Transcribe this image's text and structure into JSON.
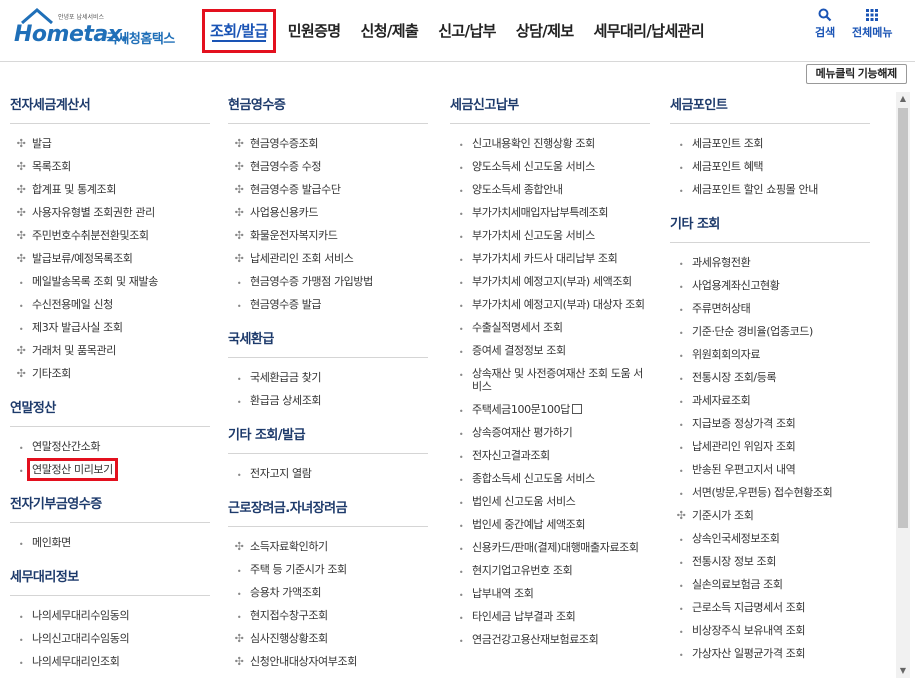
{
  "logo": {
    "small_text": "안녕포 납세서비스",
    "brand": "Hometax.",
    "korean": "국세청홈택스"
  },
  "gnb": [
    {
      "label": "조회/발급",
      "active": true
    },
    {
      "label": "민원증명"
    },
    {
      "label": "신청/제출"
    },
    {
      "label": "신고/납부"
    },
    {
      "label": "상담/제보"
    },
    {
      "label": "세무대리/납세관리"
    }
  ],
  "tools": {
    "search": "검색",
    "all_menu": "전체메뉴"
  },
  "toggle_button": "메뉴클릭 기능해제",
  "columns": [
    {
      "groups": [
        {
          "title": "전자세금계산서",
          "items": [
            {
              "label": "발급",
              "marker": "plus"
            },
            {
              "label": "목록조회",
              "marker": "plus"
            },
            {
              "label": "합계표 및 통계조회",
              "marker": "plus"
            },
            {
              "label": "사용자유형별 조회권한 관리",
              "marker": "plus"
            },
            {
              "label": "주민번호수취분전환및조회",
              "marker": "plus"
            },
            {
              "label": "발급보류/예정목록조회",
              "marker": "plus"
            },
            {
              "label": "메일발송목록 조회 및 재발송",
              "marker": "dot"
            },
            {
              "label": "수신전용메일 신청",
              "marker": "dot"
            },
            {
              "label": "제3자 발급사실 조회",
              "marker": "dot"
            },
            {
              "label": "거래처 및 품목관리",
              "marker": "plus"
            },
            {
              "label": "기타조회",
              "marker": "plus"
            }
          ]
        },
        {
          "title": "연말정산",
          "items": [
            {
              "label": "연말정산간소화",
              "marker": "dot"
            },
            {
              "label": "연말정산 미리보기",
              "marker": "dot",
              "highlighted": true
            }
          ]
        },
        {
          "title": "전자기부금영수증",
          "items": [
            {
              "label": "메인화면",
              "marker": "dot"
            }
          ]
        },
        {
          "title": "세무대리정보",
          "items": [
            {
              "label": "나의세무대리수임동의",
              "marker": "dot"
            },
            {
              "label": "나의신고대리수임동의",
              "marker": "dot"
            },
            {
              "label": "나의세무대리인조회",
              "marker": "dot"
            }
          ]
        }
      ]
    },
    {
      "groups": [
        {
          "title": "현금영수증",
          "items": [
            {
              "label": "현금영수증조회",
              "marker": "plus"
            },
            {
              "label": "현금영수증 수정",
              "marker": "plus"
            },
            {
              "label": "현금영수증 발급수단",
              "marker": "plus"
            },
            {
              "label": "사업용신용카드",
              "marker": "plus"
            },
            {
              "label": "화물운전자복지카드",
              "marker": "plus"
            },
            {
              "label": "납세관리인 조회 서비스",
              "marker": "plus"
            },
            {
              "label": "현금영수증 가맹점 가입방법",
              "marker": "dot"
            },
            {
              "label": "현금영수증 발급",
              "marker": "dot"
            }
          ]
        },
        {
          "title": "국세환급",
          "items": [
            {
              "label": "국세환급금 찾기",
              "marker": "dot"
            },
            {
              "label": "환급금 상세조회",
              "marker": "dot"
            }
          ]
        },
        {
          "title": "기타 조회/발급",
          "items": [
            {
              "label": "전자고지 열람",
              "marker": "dot"
            }
          ]
        },
        {
          "title": "근로장려금.자녀장려금",
          "items": [
            {
              "label": "소득자료확인하기",
              "marker": "plus"
            },
            {
              "label": "주택 등 기준시가 조회",
              "marker": "dot"
            },
            {
              "label": "승용차 가액조회",
              "marker": "dot"
            },
            {
              "label": "현지접수창구조회",
              "marker": "dot"
            },
            {
              "label": "심사진행상황조회",
              "marker": "plus"
            },
            {
              "label": "신청안내대상자여부조회",
              "marker": "plus"
            }
          ]
        }
      ]
    },
    {
      "groups": [
        {
          "title": "세금신고납부",
          "items": [
            {
              "label": "신고내용확인 진행상황 조회",
              "marker": "dot"
            },
            {
              "label": "양도소득세 신고도움 서비스",
              "marker": "dot"
            },
            {
              "label": "양도소득세 종합안내",
              "marker": "dot"
            },
            {
              "label": "부가가치세매입자납부특례조회",
              "marker": "dot"
            },
            {
              "label": "부가가치세 신고도움 서비스",
              "marker": "dot"
            },
            {
              "label": "부가가치세 카드사 대리납부 조회",
              "marker": "dot"
            },
            {
              "label": "부가가치세 예정고지(부과) 세액조회",
              "marker": "dot"
            },
            {
              "label": "부가가치세 예정고지(부과) 대상자 조회",
              "marker": "dot"
            },
            {
              "label": "수출실적명세서 조회",
              "marker": "dot"
            },
            {
              "label": "증여세 결정정보 조회",
              "marker": "dot"
            },
            {
              "label": "상속재산 및 사전증여재산 조회 도움 서비스",
              "marker": "dot"
            },
            {
              "label": "주택세금100문100답",
              "marker": "dot",
              "external": true
            },
            {
              "label": "상속증여재산 평가하기",
              "marker": "dot"
            },
            {
              "label": "전자신고결과조회",
              "marker": "dot"
            },
            {
              "label": "종합소득세 신고도움 서비스",
              "marker": "dot"
            },
            {
              "label": "법인세 신고도움 서비스",
              "marker": "dot"
            },
            {
              "label": "법인세 중간예납 세액조회",
              "marker": "dot"
            },
            {
              "label": "신용카드/판매(결제)대행매출자료조회",
              "marker": "dot"
            },
            {
              "label": "현지기업고유번호 조회",
              "marker": "dot"
            },
            {
              "label": "납부내역 조회",
              "marker": "dot"
            },
            {
              "label": "타인세금 납부결과 조회",
              "marker": "dot"
            },
            {
              "label": "연금건강고용산재보험료조회",
              "marker": "dot"
            }
          ]
        }
      ]
    },
    {
      "groups": [
        {
          "title": "세금포인트",
          "items": [
            {
              "label": "세금포인트 조회",
              "marker": "dot"
            },
            {
              "label": "세금포인트 혜택",
              "marker": "dot"
            },
            {
              "label": "세금포인트 할인 쇼핑몰 안내",
              "marker": "dot"
            }
          ]
        },
        {
          "title": "기타 조회",
          "items": [
            {
              "label": "과세유형전환",
              "marker": "dot"
            },
            {
              "label": "사업용계좌신고현황",
              "marker": "dot"
            },
            {
              "label": "주류면허상태",
              "marker": "dot"
            },
            {
              "label": "기준·단순 경비율(업종코드)",
              "marker": "dot"
            },
            {
              "label": "위원회회의자료",
              "marker": "dot"
            },
            {
              "label": "전통시장 조회/등록",
              "marker": "dot"
            },
            {
              "label": "과세자료조회",
              "marker": "dot"
            },
            {
              "label": "지급보증 정상가격 조회",
              "marker": "dot"
            },
            {
              "label": "납세관리인 위임자 조회",
              "marker": "dot"
            },
            {
              "label": "반송된 우편고지서 내역",
              "marker": "dot"
            },
            {
              "label": "서면(방문,우편등) 접수현황조회",
              "marker": "dot"
            },
            {
              "label": "기준시가 조회",
              "marker": "plus"
            },
            {
              "label": "상속인국세정보조회",
              "marker": "dot"
            },
            {
              "label": "전통시장 정보 조회",
              "marker": "dot"
            },
            {
              "label": "실손의료보험금 조회",
              "marker": "dot"
            },
            {
              "label": "근로소득 지급명세서 조회",
              "marker": "dot"
            },
            {
              "label": "비상장주식 보유내역 조회",
              "marker": "dot"
            },
            {
              "label": "가상자산 일평균가격 조회",
              "marker": "dot"
            }
          ]
        }
      ]
    }
  ]
}
